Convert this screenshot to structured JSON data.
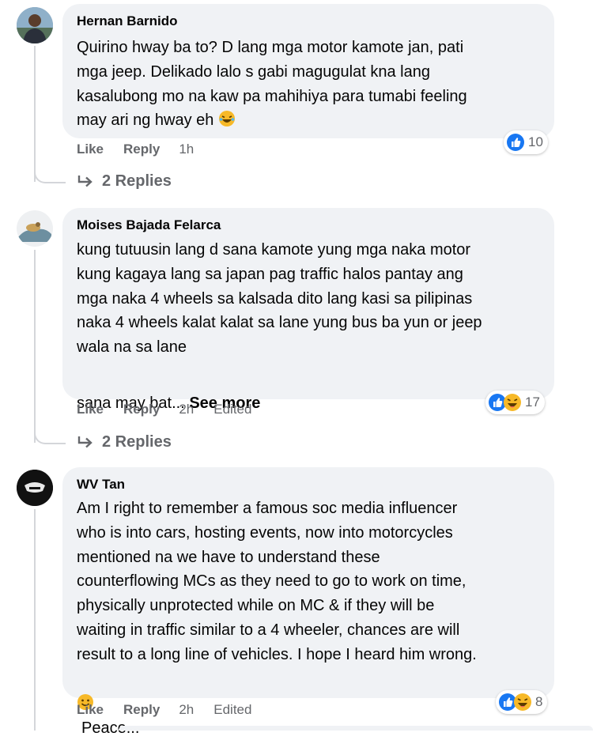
{
  "comments": [
    {
      "author": "Hernan Barnido",
      "text": "Quirino hway ba to? D lang mga motor kamote jan, pati\nmga jeep. Delikado lalo s gabi magugulat kna lang\nkasalubong mo na kaw pa mahihiya para tumabi feeling\nmay ari ng hway eh",
      "text_emoji": "laughing-face",
      "like_label": "Like",
      "reply_label": "Reply",
      "time": "1h",
      "reaction_count": "10",
      "reactions": [
        "like"
      ],
      "replies_label": "2 Replies"
    },
    {
      "author": "Moises Bajada Felarca",
      "text": "kung tutuusin lang d sana kamote yung mga naka motor\nkung kagaya lang sa japan pag traffic halos pantay ang\nmga naka 4 wheels sa kalsada dito lang kasi sa pilipinas\nnaka 4 wheels kalat kalat sa lane yung bus ba yun or jeep\nwala na sa lane",
      "more_text": "sana may bat...",
      "see_more": "See more",
      "like_label": "Like",
      "reply_label": "Reply",
      "time": "2h",
      "edited": "Edited",
      "reaction_count": "17",
      "reactions": [
        "like",
        "haha"
      ],
      "replies_label": "2 Replies"
    },
    {
      "author": "WV Tan",
      "text": "Am I right to remember a famous soc media influencer\nwho is into cars, hosting events, now into motorcycles\nmentioned na we have to understand these\ncounterflowing MCs as they need to go to work on time,\nphysically unprotected while on MC & if they will be\nwaiting in traffic similar to a 4 wheeler, chances are will\nresult to a long line of vehicles. I hope I heard him wrong.",
      "last_line_emoji": "smiling-face",
      "last_line": "Peace...",
      "like_label": "Like",
      "reply_label": "Reply",
      "time": "2h",
      "edited": "Edited",
      "reaction_count": "8",
      "reactions": [
        "like",
        "haha"
      ]
    }
  ],
  "colors": {
    "like_blue": "#1877f2",
    "haha_yellow": "#f7b928",
    "secondary_text": "#65676b",
    "bubble_bg": "#f0f2f5"
  }
}
